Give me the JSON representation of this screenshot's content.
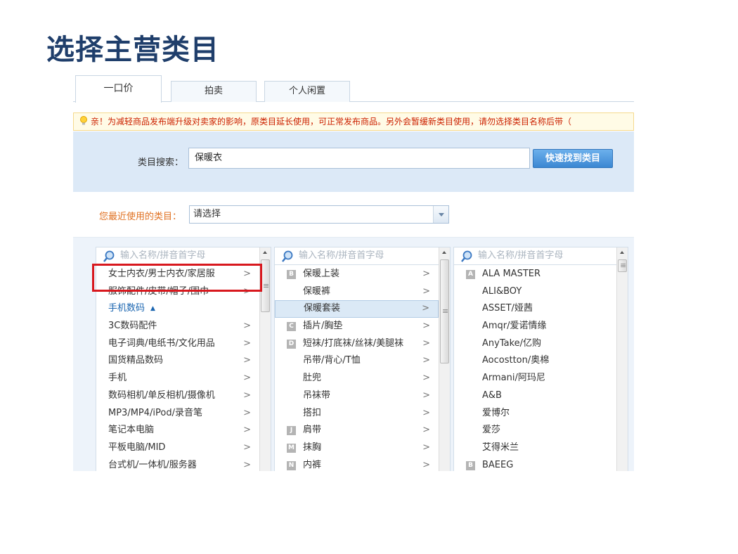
{
  "slide": {
    "title": "选择主营类目"
  },
  "tabs": [
    {
      "label": "一口价",
      "active": true
    },
    {
      "label": "拍卖",
      "active": false
    },
    {
      "label": "个人闲置",
      "active": false
    }
  ],
  "notice": {
    "text": "亲！为减轻商品发布端升级对卖家的影响，原类目延长使用，可正常发布商品。另外会暂缓新类目使用，请勿选择类目名称后带（"
  },
  "search": {
    "label": "类目搜索：",
    "value": "保暖衣",
    "button": "快速找到类目"
  },
  "recent": {
    "label": "您最近使用的类目：",
    "selected": "请选择"
  },
  "columns": {
    "placeholder": "输入名称/拼音首字母",
    "col1": [
      {
        "label": "女士内衣/男士内衣/家居服",
        "arrow": ">"
      },
      {
        "label": "服饰配件/皮带/帽子/围巾",
        "arrow": ">"
      },
      {
        "label": "手机数码",
        "group": true,
        "toggle": "▲"
      },
      {
        "label": "3C数码配件",
        "arrow": ">"
      },
      {
        "label": "电子词典/电纸书/文化用品",
        "arrow": ">"
      },
      {
        "label": "国货精品数码",
        "arrow": ">"
      },
      {
        "label": "手机",
        "arrow": ">"
      },
      {
        "label": "数码相机/单反相机/摄像机",
        "arrow": ">"
      },
      {
        "label": "MP3/MP4/iPod/录音笔",
        "arrow": ">"
      },
      {
        "label": "笔记本电脑",
        "arrow": ">"
      },
      {
        "label": "平板电脑/MID",
        "arrow": ">"
      },
      {
        "label": "台式机/一体机/服务器",
        "arrow": ">"
      }
    ],
    "col2": [
      {
        "badge": "B",
        "label": "保暖上装",
        "arrow": ">"
      },
      {
        "badge": "",
        "label": "保暖裤",
        "arrow": ">"
      },
      {
        "badge": "",
        "label": "保暖套装",
        "arrow": ">",
        "selected": true
      },
      {
        "badge": "C",
        "label": "插片/胸垫",
        "arrow": ">"
      },
      {
        "badge": "D",
        "label": "短袜/打底袜/丝袜/美腿袜",
        "arrow": ">"
      },
      {
        "badge": "",
        "label": "吊带/背心/T恤",
        "arrow": ">"
      },
      {
        "badge": "",
        "label": "肚兜",
        "arrow": ">"
      },
      {
        "badge": "",
        "label": "吊袜带",
        "arrow": ">"
      },
      {
        "badge": "",
        "label": "搭扣",
        "arrow": ">"
      },
      {
        "badge": "J",
        "label": "肩带",
        "arrow": ">"
      },
      {
        "badge": "M",
        "label": "抹胸",
        "arrow": ">"
      },
      {
        "badge": "N",
        "label": "内裤",
        "arrow": ">"
      }
    ],
    "col3": [
      {
        "badge": "A",
        "label": "ALA MASTER"
      },
      {
        "badge": "",
        "label": "ALI&BOY"
      },
      {
        "badge": "",
        "label": "ASSET/娅茜"
      },
      {
        "badge": "",
        "label": "Amqr/爱诺情缘"
      },
      {
        "badge": "",
        "label": "AnyTake/亿购"
      },
      {
        "badge": "",
        "label": "Aocostton/奥棉"
      },
      {
        "badge": "",
        "label": "Armani/阿玛尼"
      },
      {
        "badge": "",
        "label": "A&B"
      },
      {
        "badge": "",
        "label": "爱博尔"
      },
      {
        "badge": "",
        "label": "爱莎"
      },
      {
        "badge": "",
        "label": "艾得米兰"
      },
      {
        "badge": "B",
        "label": "BAEEG"
      }
    ]
  },
  "colors": {
    "title": "#1f3e6b",
    "notice": "#cc2200",
    "highlight": "#d8181e",
    "search_band": "#dce9f7"
  }
}
